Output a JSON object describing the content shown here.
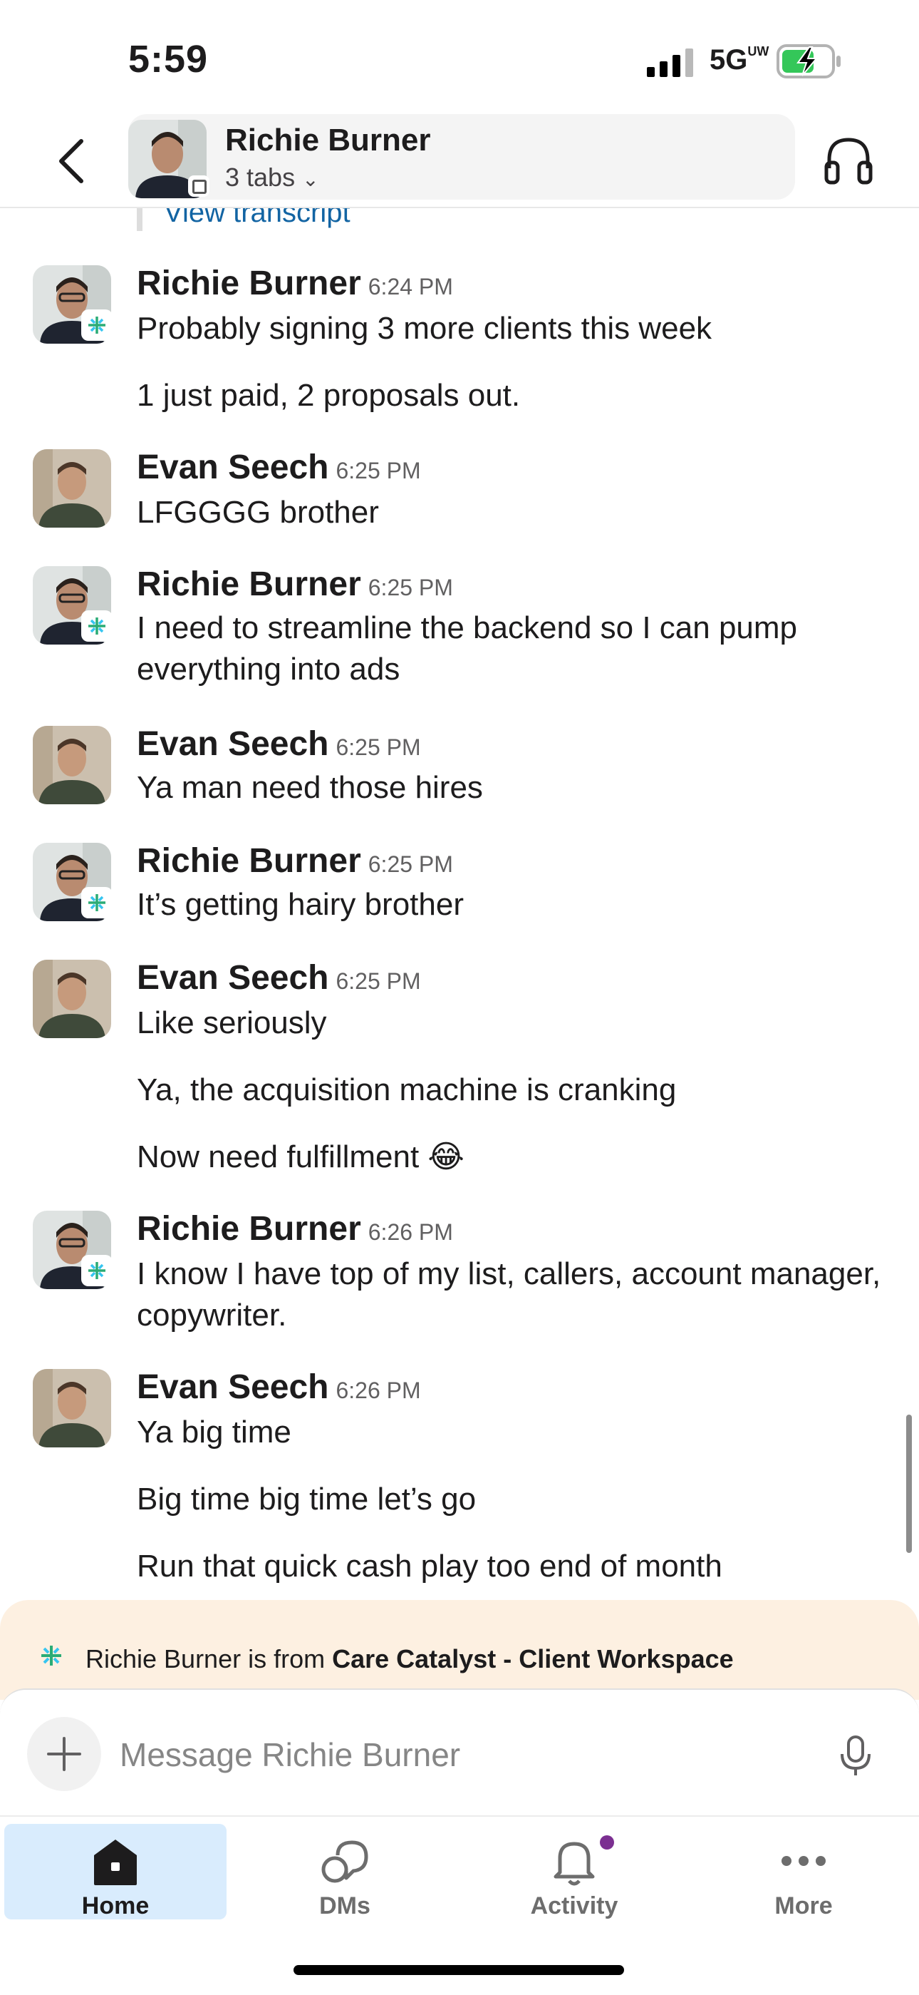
{
  "status_bar": {
    "time": "5:59",
    "network": "5G"
  },
  "header": {
    "name": "Richie Burner",
    "tabs_label": "3 tabs"
  },
  "transcript_link": "View transcript",
  "messages": [
    {
      "sender": "Richie Burner",
      "time": "6:24 PM",
      "lines": [
        "Probably signing 3 more clients this week",
        "1 just paid, 2 proposals out."
      ]
    },
    {
      "sender": "Evan Seech",
      "time": "6:25 PM",
      "lines": [
        "LFGGGG brother"
      ]
    },
    {
      "sender": "Richie Burner",
      "time": "6:25 PM",
      "lines": [
        "I need to streamline the backend  so I can pump everything into ads"
      ]
    },
    {
      "sender": "Evan Seech",
      "time": "6:25 PM",
      "lines": [
        "Ya man need those hires"
      ]
    },
    {
      "sender": "Richie Burner",
      "time": "6:25 PM",
      "lines": [
        "It’s getting hairy brother"
      ]
    },
    {
      "sender": "Evan Seech",
      "time": "6:25 PM",
      "lines": [
        "Like seriously",
        "Ya, the acquisition machine is cranking",
        "Now need fulfillment 😂"
      ]
    },
    {
      "sender": "Richie Burner",
      "time": "6:26 PM",
      "lines": [
        "I know I have top of my list, callers, account manager, copywriter."
      ]
    },
    {
      "sender": "Evan Seech",
      "time": "6:26 PM",
      "lines": [
        "Ya big time",
        "Big time big time let’s go",
        "Run that quick cash play too end of month"
      ]
    }
  ],
  "workspace_banner": {
    "prefix": "Richie Burner is from ",
    "workspace": "Care Catalyst - Client Workspace"
  },
  "composer": {
    "placeholder": "Message Richie Burner"
  },
  "tabs": [
    {
      "label": "Home",
      "icon": "home-icon",
      "active": true
    },
    {
      "label": "DMs",
      "icon": "dms-icon",
      "active": false
    },
    {
      "label": "Activity",
      "icon": "bell-icon",
      "active": false,
      "has_notification": true
    },
    {
      "label": "More",
      "icon": "more-icon",
      "active": false
    }
  ],
  "colors": {
    "link": "#1264a3",
    "banner_bg": "#fdf0e1",
    "active_tab_bg": "#d9ecfd",
    "notification_dot": "#7b2f91"
  }
}
